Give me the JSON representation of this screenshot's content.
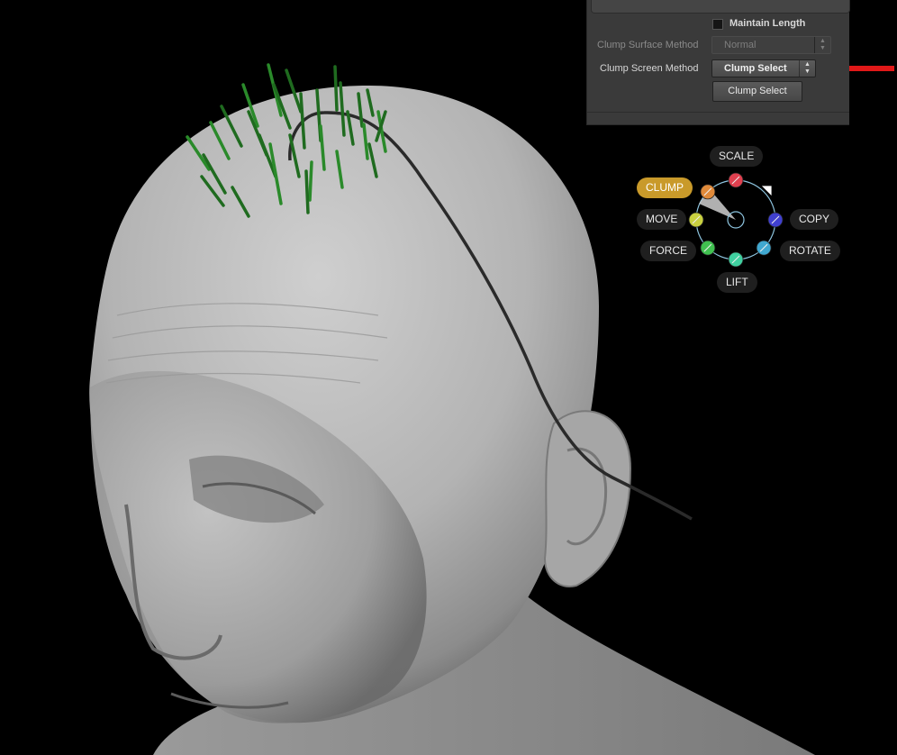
{
  "panel": {
    "maintain_length": {
      "label": "Maintain Length",
      "checked": false
    },
    "clump_surface_method": {
      "label": "Clump Surface Method",
      "value": "Normal",
      "enabled": false
    },
    "clump_screen_method": {
      "label": "Clump Screen Method",
      "value": "Clump Select",
      "enabled": true
    },
    "clump_select_button": {
      "label": "Clump Select"
    }
  },
  "radial_menu": {
    "items": [
      {
        "label": "SCALE",
        "color": "#e0404f",
        "active": false
      },
      {
        "label": "CLUMP",
        "color": "#e08a3a",
        "active": true
      },
      {
        "label": "MOVE",
        "color": "#c8d040",
        "active": false
      },
      {
        "label": "FORCE",
        "color": "#40c050",
        "active": false
      },
      {
        "label": "LIFT",
        "color": "#40d0a0",
        "active": false
      },
      {
        "label": "ROTATE",
        "color": "#40a8d0",
        "active": false
      },
      {
        "label": "COPY",
        "color": "#4040d0",
        "active": false
      }
    ],
    "active_color": "#c99a2a"
  },
  "annotations": {
    "arrow_color": "#e01818"
  }
}
